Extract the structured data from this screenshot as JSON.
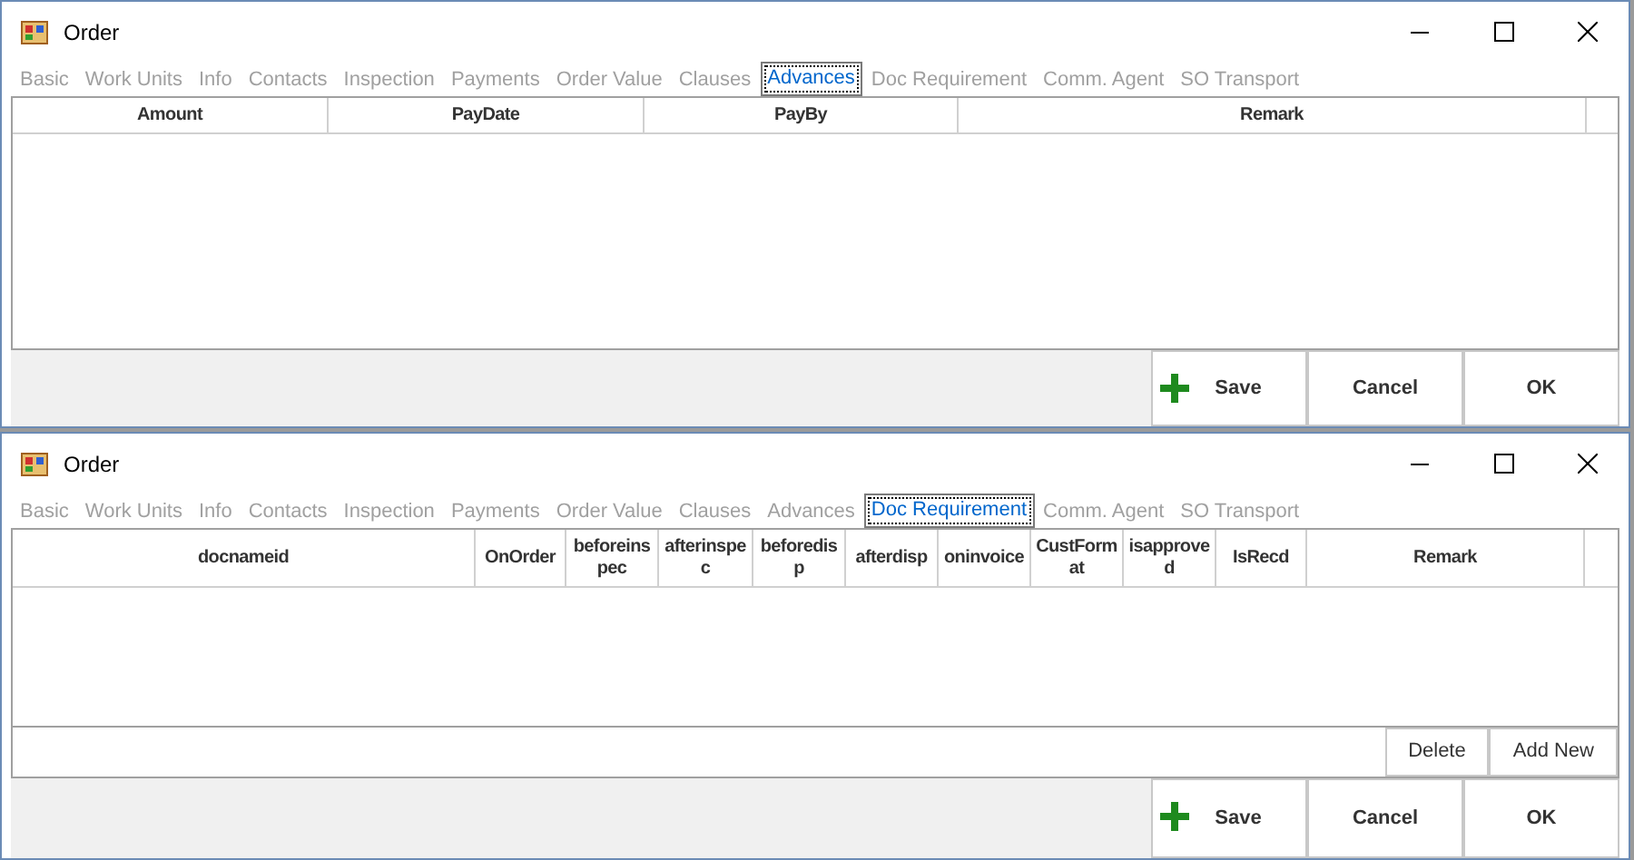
{
  "windows": [
    {
      "title": "Order",
      "tabs": [
        {
          "label": "Basic",
          "selected": false
        },
        {
          "label": "Work Units",
          "selected": false
        },
        {
          "label": "Info",
          "selected": false
        },
        {
          "label": "Contacts",
          "selected": false
        },
        {
          "label": "Inspection",
          "selected": false
        },
        {
          "label": "Payments",
          "selected": false
        },
        {
          "label": "Order Value",
          "selected": false
        },
        {
          "label": "Clauses",
          "selected": false
        },
        {
          "label": "Advances",
          "selected": true
        },
        {
          "label": "Doc Requirement",
          "selected": false
        },
        {
          "label": "Comm. Agent",
          "selected": false
        },
        {
          "label": "SO Transport",
          "selected": false
        }
      ],
      "columns": [
        "Amount",
        "PayDate",
        "PayBy",
        "Remark"
      ],
      "buttons": [
        {
          "label": "Save",
          "kind": "save"
        },
        {
          "label": "Cancel",
          "kind": "plain"
        },
        {
          "label": "OK",
          "kind": "plain"
        }
      ]
    },
    {
      "title": "Order",
      "tabs": [
        {
          "label": "Basic",
          "selected": false
        },
        {
          "label": "Work Units",
          "selected": false
        },
        {
          "label": "Info",
          "selected": false
        },
        {
          "label": "Contacts",
          "selected": false
        },
        {
          "label": "Inspection",
          "selected": false
        },
        {
          "label": "Payments",
          "selected": false
        },
        {
          "label": "Order Value",
          "selected": false
        },
        {
          "label": "Clauses",
          "selected": false
        },
        {
          "label": "Advances",
          "selected": false
        },
        {
          "label": "Doc Requirement",
          "selected": true
        },
        {
          "label": "Comm. Agent",
          "selected": false
        },
        {
          "label": "SO Transport",
          "selected": false
        }
      ],
      "columns": [
        "docnameid",
        "OnOrder",
        "beforeinspec",
        "afterinspec",
        "beforedisp",
        "afterdisp",
        "oninvoice",
        "CustFormat",
        "isapproved",
        "IsRecd",
        "Remark"
      ],
      "grid_buttons": [
        "Delete",
        "Add New"
      ],
      "buttons": [
        {
          "label": "Save",
          "kind": "save"
        },
        {
          "label": "Cancel",
          "kind": "plain"
        },
        {
          "label": "OK",
          "kind": "plain"
        }
      ]
    }
  ]
}
